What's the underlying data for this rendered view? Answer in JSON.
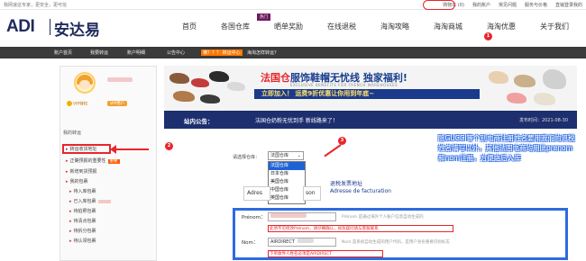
{
  "topbar": {
    "welcome": "我网速这专家，更安全，更可信",
    "links": [
      "购物车 (0)",
      "我的账户",
      "常见问题",
      "服务与价格",
      "直输登录我的"
    ]
  },
  "brand": {
    "logo_en": "ADI",
    "logo_cn": "安达易"
  },
  "main_nav": [
    "首页",
    "各国仓库",
    "晒单奖励",
    "在线退税",
    "海淘攻略",
    "海淘商城",
    "海淘优惠",
    "关于我们"
  ],
  "hot_badge": "热门",
  "sub_nav": {
    "items": [
      "账户首页",
      "我要转运",
      "账户明细",
      "公告中心",
      "海淘怎样转运?"
    ],
    "tag": "横？？？ 转运中心"
  },
  "sidebar": {
    "vip_label": "VIP特权",
    "vip_user": "VIP用户",
    "section_my_transfer": "我的转运",
    "items": [
      "转运收货地址",
      "正确预报的重要性",
      "新增到货预报",
      "我的包裹"
    ],
    "important_badge": "重要",
    "package_items": [
      "待入库包裹",
      "已入库包裹",
      "待拍照包裹",
      "待清点包裹",
      "待拆分包裹",
      "待认领包裹"
    ]
  },
  "banner": {
    "title_red": "法国仓",
    "title_blue": "服饰鞋帽无忧线",
    "title_tail": " 独家福利!",
    "subtitle": "EXCLUSIVE BENEFITS FOR FRENCH WAREHOUSES",
    "strip": "立即加入！  运费9折优惠让你用到年底~"
  },
  "notice": {
    "label": "站内公告：",
    "text": "法国仓奶粉无忧到手 新线路来了！",
    "date": "发布时间：2021-08-30"
  },
  "warehouse": {
    "label": "请选择仓库：",
    "selected": "法国仓库",
    "options": [
      "法国仓库",
      "日本仓库",
      "美国仓库",
      "中国仓库",
      "英国仓库"
    ]
  },
  "tabs": [
    "Adres",
    "son"
  ],
  "address_label": "退税发票地址\nAdresse de facturation",
  "form": {
    "prenom_label": "Prénom：",
    "prenom_hint": "Prénom 是通过海外个人账户信息自动生成的",
    "prenom_red": "此项不可修改Prénom，请仔细确认，如有疑问请与客服联系",
    "nom_label": "Nom：",
    "nom_value": "AIRDIRECT",
    "nom_hint": "Nom 是系统自动生成的用户代码，是用户身份重要识别标志",
    "nom_red": "下单收件人姓名必须是AIRDIRECT"
  },
  "annotation": "除GUCCI等个别电商注册姓名要用我们的退税姓名填写以外，其他法国电商均用此prenom和nom注册，方便之后入库",
  "markers": [
    "1",
    "2",
    "3"
  ]
}
